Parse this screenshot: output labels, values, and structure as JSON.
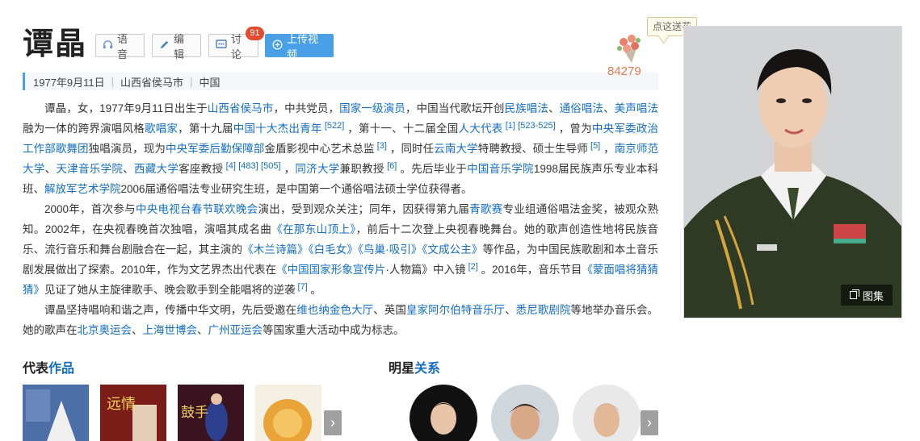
{
  "header": {
    "name": "谭晶",
    "voice_label": "语音",
    "edit_label": "编辑",
    "discuss_label": "讨论",
    "discuss_badge": "91",
    "upload_label": "上传视频"
  },
  "meta": {
    "birthday": "1977年9月11日",
    "birthplace": "山西省侯马市",
    "country": "中国"
  },
  "flower": {
    "tip": "点这送花",
    "count": "84279"
  },
  "photo": {
    "gallery_label": "图集"
  },
  "paragraphs": {
    "p1": [
      {
        "t": "谭晶，女，1977年9月11日出生于"
      },
      {
        "t": "山西省侯马市",
        "link": true
      },
      {
        "t": "，中共党员，"
      },
      {
        "t": "国家一级演员",
        "link": true
      },
      {
        "t": "，中国当代歌坛开创"
      },
      {
        "t": "民族唱法",
        "link": true
      },
      {
        "t": "、"
      },
      {
        "t": "通俗唱法",
        "link": true
      },
      {
        "t": "、"
      },
      {
        "t": "美声唱法",
        "link": true
      },
      {
        "t": "融为一体的跨界演唱风格"
      },
      {
        "t": "歌唱家",
        "link": true
      },
      {
        "t": "，第十九届"
      },
      {
        "t": "中国十大杰出青年",
        "link": true
      },
      {
        "t": " [522]",
        "sup": true
      },
      {
        "t": " ，第十一、十二届全国"
      },
      {
        "t": "人大代表",
        "link": true
      },
      {
        "t": " [1]",
        "sup": true
      },
      {
        "t": " [523-525]",
        "sup": true
      },
      {
        "t": " ，曾为"
      },
      {
        "t": "中央军委政治工作部歌舞团",
        "link": true
      },
      {
        "t": "独唱演员，现为"
      },
      {
        "t": "中央军委后勤保障部",
        "link": true
      },
      {
        "t": "金盾影视中心艺术总监"
      },
      {
        "t": " [3]",
        "sup": true
      },
      {
        "t": " ，同时任"
      },
      {
        "t": "云南大学",
        "link": true
      },
      {
        "t": "特聘教授、硕士生导师"
      },
      {
        "t": " [5]",
        "sup": true
      },
      {
        "t": " ，"
      },
      {
        "t": "南京师范大学",
        "link": true
      },
      {
        "t": "、"
      },
      {
        "t": "天津音乐学院",
        "link": true
      },
      {
        "t": "、"
      },
      {
        "t": "西藏大学",
        "link": true
      },
      {
        "t": "客座教授"
      },
      {
        "t": " [4]",
        "sup": true
      },
      {
        "t": " [483]",
        "sup": true
      },
      {
        "t": " [505]",
        "sup": true
      },
      {
        "t": " ，"
      },
      {
        "t": "同济大学",
        "link": true
      },
      {
        "t": "兼职教授"
      },
      {
        "t": " [6]",
        "sup": true
      },
      {
        "t": " 。先后毕业于"
      },
      {
        "t": "中国音乐学院",
        "link": true
      },
      {
        "t": "1998届民族声乐专业本科班、"
      },
      {
        "t": "解放军艺术学院",
        "link": true
      },
      {
        "t": "2006届通俗唱法专业研究生班，是中国第一个通俗唱法硕士学位获得者。"
      }
    ],
    "p2": [
      {
        "t": "2000年，首次参与"
      },
      {
        "t": "中央电视台春节联欢晚会",
        "link": true
      },
      {
        "t": "演出，受到观众关注；同年，因获得第九届"
      },
      {
        "t": "青歌赛",
        "link": true
      },
      {
        "t": "专业组通俗唱法金奖，被观众熟知。2002年，在央视春晚首次独唱，演唱其成名曲"
      },
      {
        "t": "《在那东山顶上》",
        "link": true
      },
      {
        "t": "，前后十二次登上央视春晚舞台。她的歌声创造性地将民族音乐、流行音乐和舞台剧融合在一起，其主演的"
      },
      {
        "t": "《木兰诗篇》",
        "link": true
      },
      {
        "t": "《白毛女》",
        "link": true
      },
      {
        "t": "《鸟巢·吸引》",
        "link": true
      },
      {
        "t": "《文成公主》",
        "link": true
      },
      {
        "t": "等作品，为中国民族歌剧和本土音乐剧发展做出了探索。2010年，作为文艺界杰出代表在"
      },
      {
        "t": "《中国国家形象宣传片",
        "link": true
      },
      {
        "t": "·人物篇》中入镜"
      },
      {
        "t": " [2]",
        "sup": true
      },
      {
        "t": " 。2016年，音乐节目"
      },
      {
        "t": "《蒙面唱将猜猜猜》",
        "link": true
      },
      {
        "t": "见证了她从主旋律歌手、晚会歌手到全能唱将的逆袭"
      },
      {
        "t": " [7]",
        "sup": true
      },
      {
        "t": " 。"
      }
    ],
    "p3": [
      {
        "t": "谭晶坚持唱响和谐之声，传播中华文明，先后受邀在"
      },
      {
        "t": "维也纳金色大厅",
        "link": true
      },
      {
        "t": "、英国"
      },
      {
        "t": "皇家阿尔伯特音乐厅",
        "link": true
      },
      {
        "t": "、"
      },
      {
        "t": "悉尼歌剧院",
        "link": true
      },
      {
        "t": "等地举办音乐会。她的歌声在"
      },
      {
        "t": "北京奥运会",
        "link": true
      },
      {
        "t": "、"
      },
      {
        "t": "上海世博会",
        "link": true
      },
      {
        "t": "、"
      },
      {
        "t": "广州亚运会",
        "link": true
      },
      {
        "t": "等国家重大活动中成为标志。"
      }
    ]
  },
  "works": {
    "title_a": "代表",
    "title_b": "作品",
    "cover2_text": "远情",
    "cover3_text": "鼓手"
  },
  "relations": {
    "title_a": "明星",
    "title_b": "关系"
  },
  "icons": {
    "voice": "headphone-icon",
    "edit": "pencil-icon",
    "discuss": "chat-icon",
    "upload": "plus-circle-icon",
    "gallery": "gallery-icon",
    "flower": "flower-bouquet-icon",
    "next": "chevron-right-icon"
  },
  "colors": {
    "link": "#136ec2",
    "accent_blue": "#4aa0e6",
    "badge_red": "#e5492e",
    "flower_count": "#e07850"
  }
}
